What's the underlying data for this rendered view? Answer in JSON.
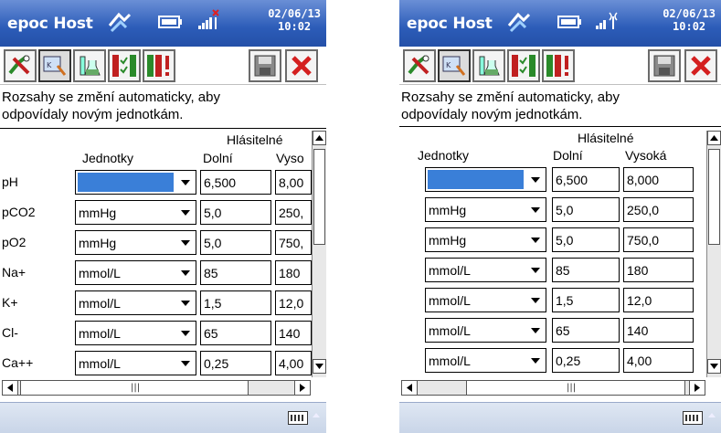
{
  "left": {
    "titlebar": {
      "title": "epoc Host",
      "date": "02/06/13",
      "time": "10:02"
    },
    "info_text_line1": "Rozsahy se změní automaticky, aby",
    "info_text_line2": "odpovídaly novým jednotkám.",
    "headers": {
      "reported": "Hlásitelné",
      "units": "Jednotky",
      "low": "Dolní",
      "high": "Vyso"
    },
    "rows": [
      {
        "label": "pH",
        "unit": "",
        "low": "6,500",
        "high": "8,00"
      },
      {
        "label": "pCO2",
        "unit": "mmHg",
        "low": "5,0",
        "high": "250,"
      },
      {
        "label": "pO2",
        "unit": "mmHg",
        "low": "5,0",
        "high": "750,"
      },
      {
        "label": "Na+",
        "unit": "mmol/L",
        "low": "85",
        "high": "180"
      },
      {
        "label": "K+",
        "unit": "mmol/L",
        "low": "1,5",
        "high": "12,0"
      },
      {
        "label": "Cl-",
        "unit": "mmol/L",
        "low": "65",
        "high": "140"
      },
      {
        "label": "Ca++",
        "unit": "mmol/L",
        "low": "0,25",
        "high": "4,00"
      }
    ]
  },
  "right": {
    "titlebar": {
      "title": "epoc Host",
      "date": "02/06/13",
      "time": "10:02"
    },
    "info_text_line1": "Rozsahy se změní automaticky, aby",
    "info_text_line2": "odpovídaly novým jednotkám.",
    "headers": {
      "reported": "Hlásitelné",
      "units": "Jednotky",
      "low": "Dolní",
      "high": "Vysoká"
    },
    "rows": [
      {
        "unit": "",
        "low": "6,500",
        "high": "8,000"
      },
      {
        "unit": "mmHg",
        "low": "5,0",
        "high": "250,0"
      },
      {
        "unit": "mmHg",
        "low": "5,0",
        "high": "750,0"
      },
      {
        "unit": "mmol/L",
        "low": "85",
        "high": "180"
      },
      {
        "unit": "mmol/L",
        "low": "1,5",
        "high": "12,0"
      },
      {
        "unit": "mmol/L",
        "low": "65",
        "high": "140"
      },
      {
        "unit": "mmol/L",
        "low": "0,25",
        "high": "4,00"
      }
    ]
  },
  "icons": {
    "toolbar": [
      "tools-icon",
      "test-panel-icon",
      "lab-beaker-icon",
      "checklist-icon",
      "alert-list-icon",
      "save-icon",
      "close-icon"
    ],
    "status": [
      "sync-icon",
      "battery-icon",
      "signal-icon",
      "keyboard-icon"
    ]
  },
  "colors": {
    "titlebar": "#2c5cb8",
    "selected_field": "#3a7fd8",
    "close_red": "#d42020"
  }
}
